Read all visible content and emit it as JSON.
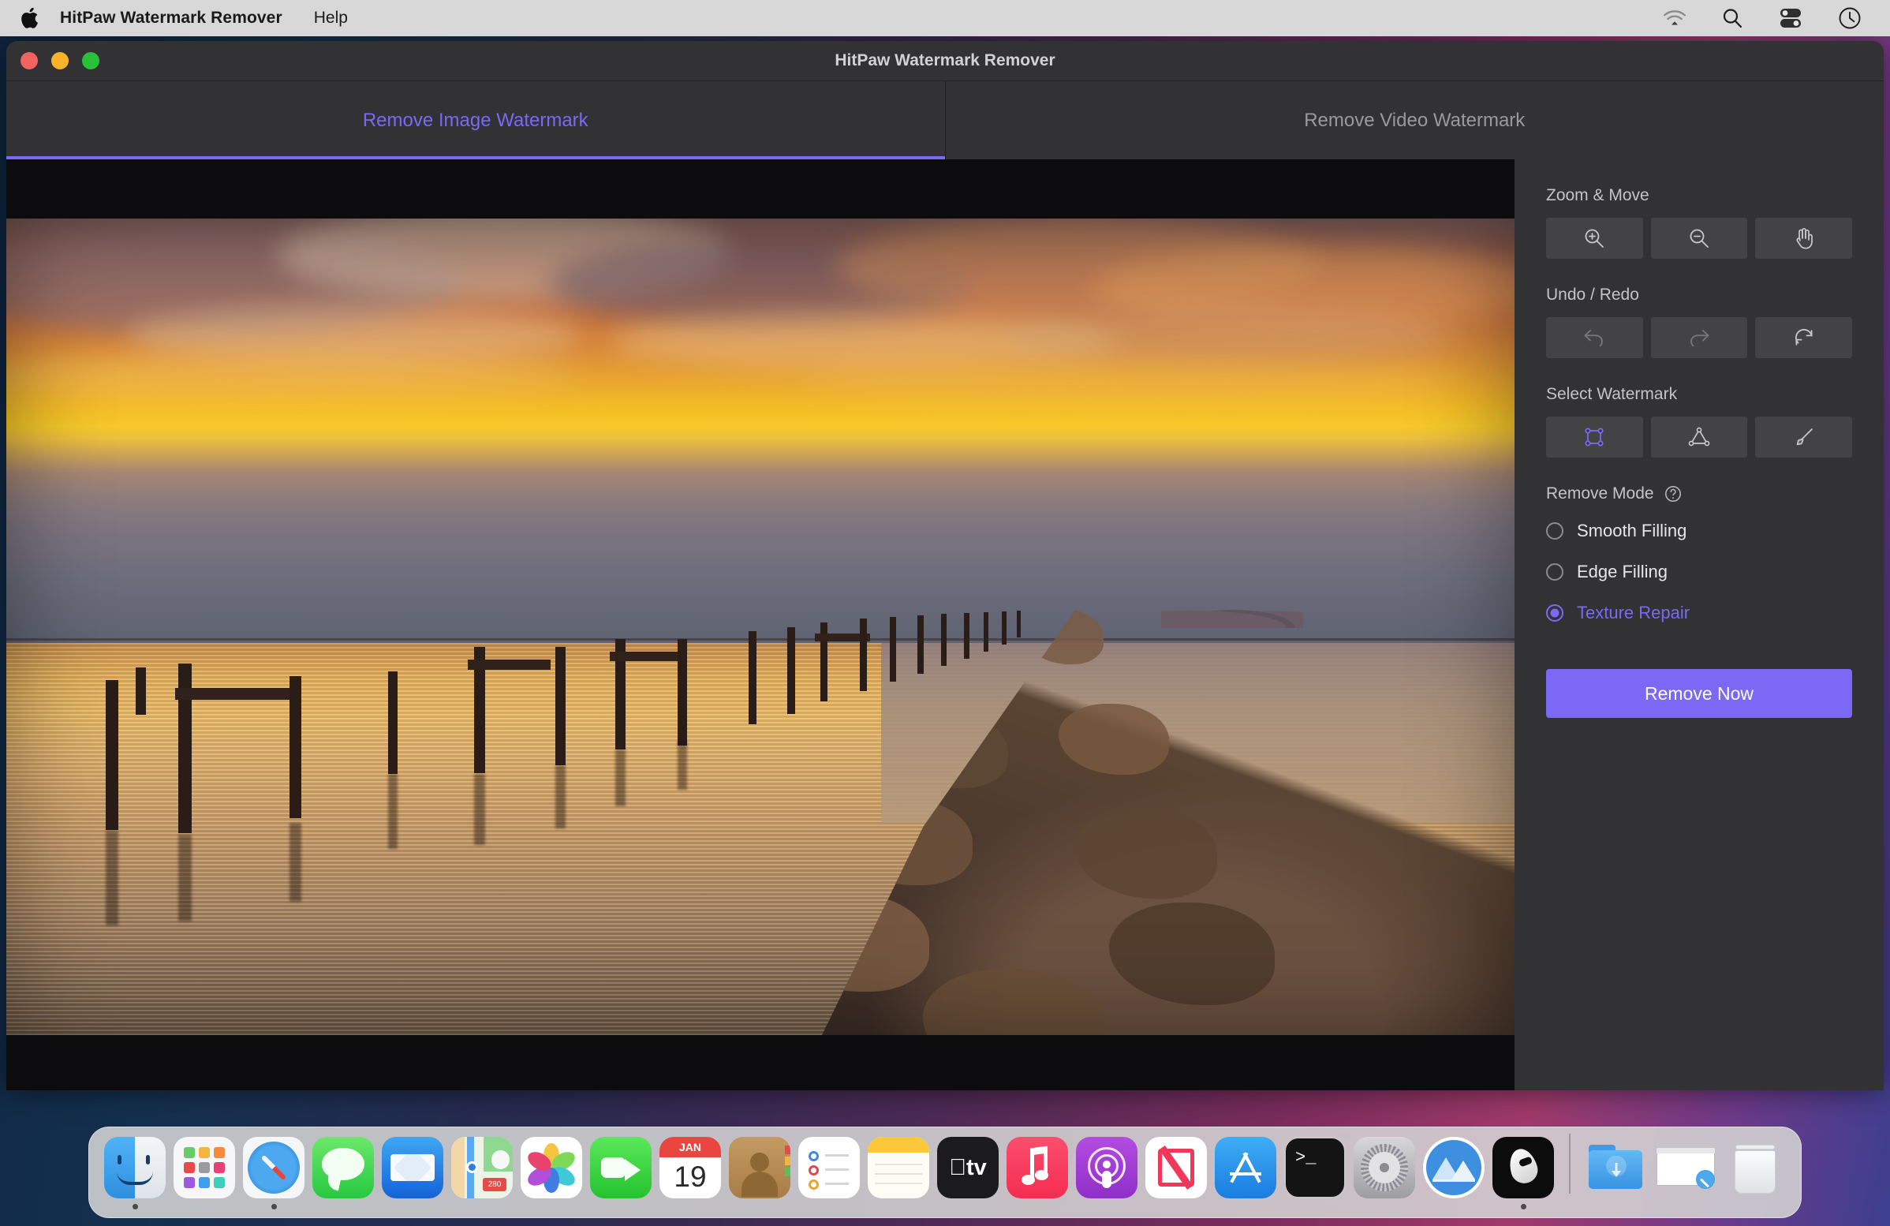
{
  "menubar": {
    "apple_icon": "apple-logo-icon",
    "app_title": "HitPaw Watermark Remover",
    "menus": [
      "Help"
    ],
    "status_icons": [
      "wifi-icon",
      "search-icon",
      "control-center-icon",
      "siri-clock-icon"
    ]
  },
  "window": {
    "title": "HitPaw Watermark Remover",
    "traffic_lights": [
      "close-button",
      "minimize-button",
      "maximize-button"
    ]
  },
  "tabs": [
    {
      "label": "Remove Image Watermark",
      "active": true
    },
    {
      "label": "Remove Video Watermark",
      "active": false
    }
  ],
  "canvas": {
    "image_description": "Sunset seascape with wooden pier posts and a rocky breakwater"
  },
  "sidebar": {
    "sections": [
      {
        "label": "Zoom & Move",
        "buttons": [
          {
            "name": "zoom-in-icon",
            "disabled": false
          },
          {
            "name": "zoom-out-icon",
            "disabled": false
          },
          {
            "name": "hand-pan-icon",
            "disabled": false
          }
        ]
      },
      {
        "label": "Undo / Redo",
        "buttons": [
          {
            "name": "undo-icon",
            "disabled": true
          },
          {
            "name": "redo-icon",
            "disabled": true
          },
          {
            "name": "reset-icon",
            "disabled": false
          }
        ]
      },
      {
        "label": "Select Watermark",
        "buttons": [
          {
            "name": "rectangle-select-icon",
            "disabled": false,
            "active": true
          },
          {
            "name": "polygon-select-icon",
            "disabled": false,
            "active": false
          },
          {
            "name": "brush-select-icon",
            "disabled": false,
            "active": false
          }
        ]
      }
    ],
    "remove_mode": {
      "label": "Remove Mode",
      "help_icon": "help-circle-icon",
      "options": [
        {
          "label": "Smooth Filling",
          "selected": false
        },
        {
          "label": "Edge Filling",
          "selected": false
        },
        {
          "label": "Texture Repair",
          "selected": true
        }
      ]
    },
    "remove_button": "Remove Now"
  },
  "colors": {
    "accent": "#7b68f5",
    "panel": "#323234",
    "tool_button": "#434346",
    "canvas": "#0c0c0e",
    "menubar": "#d8d8d8"
  },
  "dock": {
    "items": [
      {
        "name": "finder-icon",
        "running": true
      },
      {
        "name": "launchpad-icon",
        "running": false
      },
      {
        "name": "safari-icon",
        "running": true
      },
      {
        "name": "messages-icon",
        "running": false
      },
      {
        "name": "mail-icon",
        "running": false
      },
      {
        "name": "maps-icon",
        "running": false
      },
      {
        "name": "photos-icon",
        "running": false
      },
      {
        "name": "facetime-icon",
        "running": false
      },
      {
        "name": "calendar-icon",
        "running": false,
        "month": "JAN",
        "day": "19"
      },
      {
        "name": "contacts-icon",
        "running": false
      },
      {
        "name": "reminders-icon",
        "running": false
      },
      {
        "name": "notes-icon",
        "running": false
      },
      {
        "name": "appletv-icon",
        "running": false,
        "label": "tv"
      },
      {
        "name": "music-icon",
        "running": false
      },
      {
        "name": "podcasts-icon",
        "running": false
      },
      {
        "name": "news-icon",
        "running": false
      },
      {
        "name": "app-store-icon",
        "running": false
      },
      {
        "name": "terminal-icon",
        "running": false
      },
      {
        "name": "system-preferences-icon",
        "running": false
      },
      {
        "name": "mountain-app-icon",
        "running": false
      },
      {
        "name": "hitpaw-icon",
        "running": true
      }
    ],
    "right_items": [
      {
        "name": "downloads-folder-icon"
      },
      {
        "name": "safari-window-preview-icon"
      },
      {
        "name": "trash-icon"
      }
    ]
  }
}
